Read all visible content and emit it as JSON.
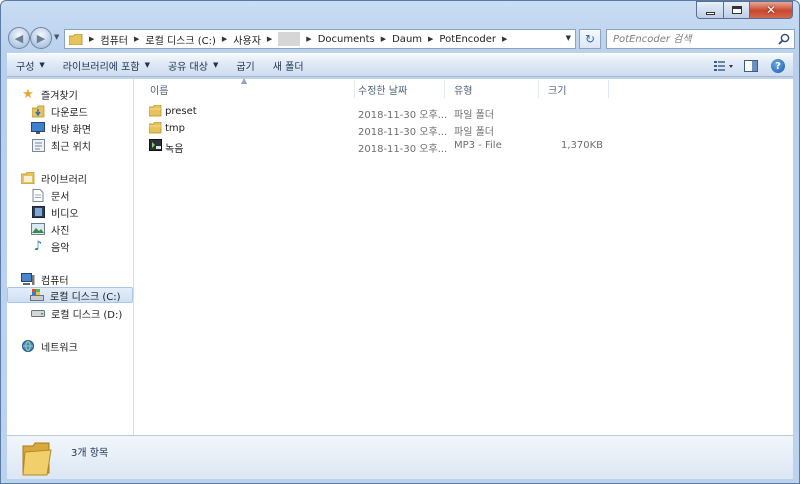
{
  "nav_buttons": {
    "back": "◀",
    "forward": "▶"
  },
  "address": {
    "crumbs": [
      "컴퓨터",
      "로컬 디스크 (C:)",
      "사용자",
      "",
      "Documents",
      "Daum",
      "PotEncoder"
    ]
  },
  "search": {
    "placeholder": "PotEncoder 검색"
  },
  "toolbar": {
    "organize": "구성",
    "include_library": "라이브러리에 포함",
    "share": "공유 대상",
    "burn": "굽기",
    "new_folder": "새 폴더",
    "help": "?"
  },
  "sidebar": {
    "favorites": "즐겨찾기",
    "downloads": "다운로드",
    "desktop": "바탕 화면",
    "recent": "최근 위치",
    "libraries": "라이브러리",
    "documents": "문서",
    "videos": "비디오",
    "pictures": "사진",
    "music": "음악",
    "computer": "컴퓨터",
    "drive_c": "로컬 디스크 (C:)",
    "drive_d": "로컬 디스크 (D:)",
    "network": "네트워크"
  },
  "columns": {
    "name": "이름",
    "date": "수정한 날짜",
    "type": "유형",
    "size": "크기"
  },
  "files": [
    {
      "name": "preset",
      "date": "2018-11-30 오후...",
      "type": "파일 폴더",
      "size": "",
      "icon": "folder-icon"
    },
    {
      "name": "tmp",
      "date": "2018-11-30 오후...",
      "type": "파일 폴더",
      "size": "",
      "icon": "folder-icon"
    },
    {
      "name": "녹음",
      "date": "2018-11-30 오후...",
      "type": "MP3 - File",
      "size": "1,370KB",
      "icon": "media-file-icon"
    }
  ],
  "status": {
    "item_count": "3개 항목"
  },
  "colors": {
    "accent": "#2d6bb7",
    "frame": "#bcd3ee",
    "selection": "#cfe0f4"
  }
}
